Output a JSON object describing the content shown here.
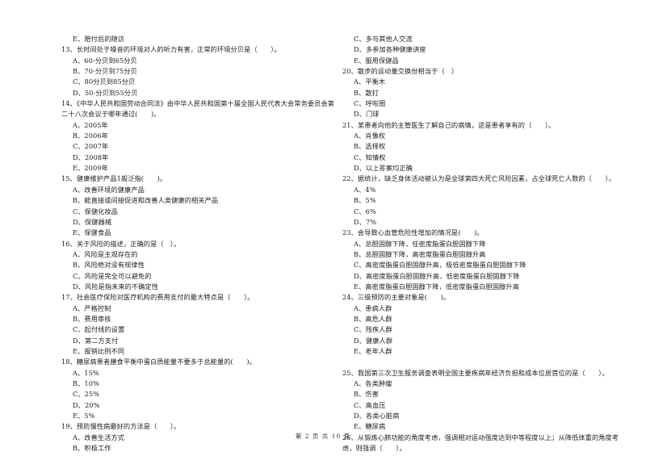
{
  "left_column": [
    {
      "type": "opt",
      "text": "E、赔付后的随访"
    },
    {
      "type": "q",
      "text": "13、长时间处于噪音的环境对人的听力有害，正常的环境分贝是（　　）。"
    },
    {
      "type": "opt",
      "text": "A、60-分贝到65分贝"
    },
    {
      "type": "opt",
      "text": "B、70-分贝到75分贝"
    },
    {
      "type": "opt",
      "text": "C、80分贝到85分贝"
    },
    {
      "type": "opt",
      "text": "D、50-分贝到55分贝"
    },
    {
      "type": "q",
      "text": "14、《中华人民共和国劳动合同法》由中华人民共和国第十届全国人民代表大会常务委员会第"
    },
    {
      "type": "q",
      "text": "二十八次会议于哪年通过(　　)。"
    },
    {
      "type": "opt",
      "text": "A、2005年"
    },
    {
      "type": "opt",
      "text": "B、2006年"
    },
    {
      "type": "opt",
      "text": "C、2007年"
    },
    {
      "type": "opt",
      "text": "D、2008年"
    },
    {
      "type": "opt",
      "text": "E、2009年"
    },
    {
      "type": "q",
      "text": "15、健康维护产品1般泛指(　　)。"
    },
    {
      "type": "opt",
      "text": "A、改善环境的健康产品"
    },
    {
      "type": "opt",
      "text": "B、能直接或间接促进和改善人类健康的相关产品"
    },
    {
      "type": "opt",
      "text": "C、保健化妆品"
    },
    {
      "type": "opt",
      "text": "D、保健器械"
    },
    {
      "type": "opt",
      "text": "E、保健食品"
    },
    {
      "type": "q",
      "text": "16、关于风险的描述，正确的是（　）。"
    },
    {
      "type": "opt",
      "text": "A、风险是主观存在的"
    },
    {
      "type": "opt",
      "text": "B、风险绝对没有规律性"
    },
    {
      "type": "opt",
      "text": "C、风险是完全可以避免的"
    },
    {
      "type": "opt",
      "text": "D、风险是指未来的不确定性"
    },
    {
      "type": "q",
      "text": "17、社会医疗保险对医疗机构的费用支付的最大特点是（　　）。"
    },
    {
      "type": "opt",
      "text": "A、严格控制"
    },
    {
      "type": "opt",
      "text": "B、费用审核"
    },
    {
      "type": "opt",
      "text": "C、起付线的设置"
    },
    {
      "type": "opt",
      "text": "D、第二方支付"
    },
    {
      "type": "opt",
      "text": "E、报销比例不同"
    },
    {
      "type": "q",
      "text": "18、糖尿病患者膳食平衡中蛋白质能量不要多于总能量的(　　)。"
    },
    {
      "type": "opt",
      "text": "A、15%"
    },
    {
      "type": "opt",
      "text": "B、10%"
    },
    {
      "type": "opt",
      "text": "C、25%"
    },
    {
      "type": "opt",
      "text": "D、20%"
    },
    {
      "type": "opt",
      "text": "E、5%"
    },
    {
      "type": "q",
      "text": "19、预防慢性病最好的方法是（　　）。"
    },
    {
      "type": "opt",
      "text": "A、改善生活方式"
    },
    {
      "type": "opt",
      "text": "B、积极工作"
    }
  ],
  "right_column": [
    {
      "type": "opt",
      "text": "C、多与其他人交流"
    },
    {
      "type": "opt",
      "text": "D、多参加各种健康讲座"
    },
    {
      "type": "opt",
      "text": "E、服用保健品"
    },
    {
      "type": "q",
      "text": "20、散步的运动量交换份相当于（　）"
    },
    {
      "type": "opt",
      "text": "A、平衡木"
    },
    {
      "type": "opt",
      "text": "B、散打"
    },
    {
      "type": "opt",
      "text": "C、呼啦圈"
    },
    {
      "type": "opt",
      "text": "D、门球"
    },
    {
      "type": "q",
      "text": "21、某患者向他的主管医生了解自己的病情，这是患者享有的（　　）。"
    },
    {
      "type": "opt",
      "text": "A、肖像权"
    },
    {
      "type": "opt",
      "text": "B、选择权"
    },
    {
      "type": "opt",
      "text": "C、知情权"
    },
    {
      "type": "opt",
      "text": "D、以上答案均正确"
    },
    {
      "type": "q",
      "text": "22、据统计，缺乏身体活动被认为是全球第四大死亡风险因素，占全球死亡人数的（　　）。"
    },
    {
      "type": "opt",
      "text": "A、4%"
    },
    {
      "type": "opt",
      "text": "B、5%"
    },
    {
      "type": "opt",
      "text": "C、6%"
    },
    {
      "type": "opt",
      "text": "D、7%"
    },
    {
      "type": "q",
      "text": "23、会导致心血管危险性增加的情况是(　　)。"
    },
    {
      "type": "opt",
      "text": "A、总胆固醇下降，任密度脂蛋白胆固醇下降"
    },
    {
      "type": "opt",
      "text": "B、总胆固醇下降，高密度脂蛋白胆固醇升高"
    },
    {
      "type": "opt",
      "text": "C、高密度脂蛋白胆固醇升高，极低密度脂蛋白胆固醇下降"
    },
    {
      "type": "opt",
      "text": "D、高密度脂蛋白胆固醇升高，低密度脂蛋白胆固醇下降"
    },
    {
      "type": "opt",
      "text": "E、高密度脂蛋白胆固醇下降，低密度脂蛋白胆固醇升高"
    },
    {
      "type": "q",
      "text": "24、三级预防的主要对象是(　　)。"
    },
    {
      "type": "opt",
      "text": "A、患病人群"
    },
    {
      "type": "opt",
      "text": "B、高危人群"
    },
    {
      "type": "opt",
      "text": "C、残疾人群"
    },
    {
      "type": "opt",
      "text": "D、健康人群"
    },
    {
      "type": "opt",
      "text": "E、老年人群"
    },
    {
      "type": "gap",
      "text": ""
    },
    {
      "type": "q",
      "text": "25、我国第三次卫生服务调查表明全国主要疾病年经济负担和成本位居首位的是（　　）。"
    },
    {
      "type": "opt",
      "text": "A、各类肿瘤"
    },
    {
      "type": "opt",
      "text": "B、伤害"
    },
    {
      "type": "opt",
      "text": "C、高血压"
    },
    {
      "type": "opt",
      "text": "D、各类心脏病"
    },
    {
      "type": "opt",
      "text": "E、糖尿病"
    },
    {
      "type": "q",
      "text": "26、从锻炼心肺功能的角度考虑，强调相对运动强度达到中等程度以上；从降低体重的角度考"
    },
    {
      "type": "q",
      "text": "虑，则强调（　　）。"
    }
  ],
  "footer": {
    "page_label": "第 2 页 共 10 页"
  }
}
